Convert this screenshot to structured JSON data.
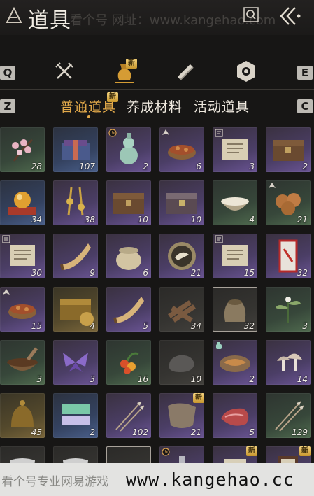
{
  "header": {
    "title": "道具",
    "watermark": "看个号 网址：www.kangehao.com"
  },
  "keys": {
    "prev_category": "Q",
    "next_category": "E",
    "prev_subtab": "Z",
    "next_subtab": "C"
  },
  "categories": [
    {
      "name": "weapons-icon",
      "active": false,
      "new": false
    },
    {
      "name": "bag-icon",
      "active": true,
      "new": true,
      "new_label": "新"
    },
    {
      "name": "scroll-icon",
      "active": false,
      "new": false
    },
    {
      "name": "emblem-icon",
      "active": false,
      "new": false
    }
  ],
  "subtabs": [
    {
      "label": "普通道具",
      "active": true,
      "new_label": "新"
    },
    {
      "label": "养成材料",
      "active": false
    },
    {
      "label": "活动道具",
      "active": false
    }
  ],
  "rows": [
    [
      {
        "icon": "plum-blossom",
        "count": "28",
        "rarity": "green"
      },
      {
        "icon": "gift-box",
        "count": "107",
        "rarity": "blue"
      },
      {
        "icon": "gourd-vase",
        "count": "2",
        "rarity": "purple",
        "badge": "timer"
      },
      {
        "icon": "stew-bowl",
        "count": "6",
        "rarity": "purple",
        "badge": "arrow"
      },
      {
        "icon": "letter",
        "count": "3",
        "rarity": "purple",
        "badge": "page"
      },
      {
        "icon": "wooden-chest",
        "count": "2",
        "rarity": "purple"
      }
    ],
    [
      {
        "icon": "orb-pedestal",
        "count": "34",
        "rarity": "blue"
      },
      {
        "icon": "charm-ribbon",
        "count": "38",
        "rarity": "purple"
      },
      {
        "icon": "wooden-chest",
        "count": "10",
        "rarity": "purple"
      },
      {
        "icon": "iron-chest",
        "count": "10",
        "rarity": "purple"
      },
      {
        "icon": "porridge-bowl",
        "count": "4",
        "rarity": "green"
      },
      {
        "icon": "cookies",
        "count": "21",
        "rarity": "green",
        "badge": "arrow"
      }
    ],
    [
      {
        "icon": "letter",
        "count": "30",
        "rarity": "purple",
        "badge": "page"
      },
      {
        "icon": "horn",
        "count": "9",
        "rarity": "purple"
      },
      {
        "icon": "jar",
        "count": "6",
        "rarity": "purple"
      },
      {
        "icon": "bird-medal",
        "count": "21",
        "rarity": "purple"
      },
      {
        "icon": "letter",
        "count": "15",
        "rarity": "purple",
        "badge": "page"
      },
      {
        "icon": "red-scroll",
        "count": "32",
        "rarity": "purple"
      }
    ],
    [
      {
        "icon": "stew-bowl",
        "count": "15",
        "rarity": "purple",
        "badge": "arrow"
      },
      {
        "icon": "golden-chest",
        "count": "4",
        "rarity": "gold"
      },
      {
        "icon": "horn",
        "count": "5",
        "rarity": "purple"
      },
      {
        "icon": "firewood",
        "count": "34",
        "rarity": "plain"
      },
      {
        "icon": "grain-sack",
        "count": "32",
        "rarity": "plain",
        "selected": true
      },
      {
        "icon": "herb",
        "count": "3",
        "rarity": "green"
      }
    ],
    [
      {
        "icon": "mortar-bowl",
        "count": "3",
        "rarity": "green"
      },
      {
        "icon": "butterfly",
        "count": "3",
        "rarity": "purple"
      },
      {
        "icon": "berries",
        "count": "16",
        "rarity": "green"
      },
      {
        "icon": "stone",
        "count": "10",
        "rarity": "plain"
      },
      {
        "icon": "fish-plate",
        "count": "2",
        "rarity": "purple",
        "badge": "bottle"
      },
      {
        "icon": "mushrooms",
        "count": "14",
        "rarity": "purple"
      }
    ],
    [
      {
        "icon": "bronze-bell",
        "count": "45",
        "rarity": "gold"
      },
      {
        "icon": "jade-boxes",
        "count": "2",
        "rarity": "blue"
      },
      {
        "icon": "arrows",
        "count": "102",
        "rarity": "purple"
      },
      {
        "icon": "fur-pelt",
        "count": "21",
        "rarity": "purple",
        "new": true
      },
      {
        "icon": "meat",
        "count": "5",
        "rarity": "purple"
      },
      {
        "icon": "arrows",
        "count": "129",
        "rarity": "green"
      }
    ],
    [
      {
        "icon": "cloth",
        "count": "",
        "rarity": "plain"
      },
      {
        "icon": "cloth",
        "count": "",
        "rarity": "plain"
      },
      {
        "icon": "bundle",
        "count": "",
        "rarity": "plain",
        "selected": true
      },
      {
        "icon": "vase",
        "count": "",
        "rarity": "purple",
        "badge": "timer"
      },
      {
        "icon": "scroll",
        "count": "",
        "rarity": "purple",
        "new": true
      },
      {
        "icon": "book",
        "count": "",
        "rarity": "purple",
        "new": true
      }
    ]
  ],
  "new_label": "新",
  "footer": {
    "left_text": "看个号专业网易游戏",
    "url": "www.kangehao.cc"
  },
  "colors": {
    "accent": "#e2a94a",
    "purple": "#5e4b86",
    "green": "#3f5a3e",
    "blue": "#3d4f70",
    "gold": "#6a5a2e"
  }
}
